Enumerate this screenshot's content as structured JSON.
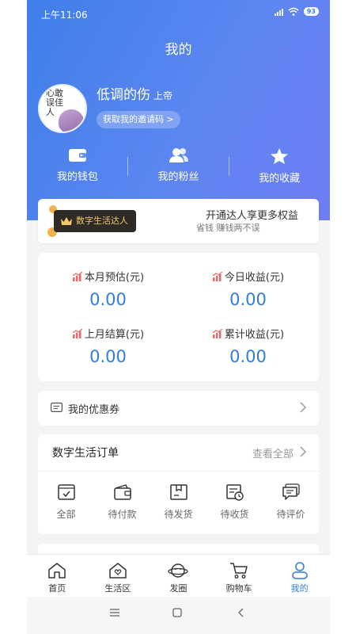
{
  "status_bar": {
    "time": "上午11:06",
    "battery": "93"
  },
  "header": {
    "title": "我的"
  },
  "profile": {
    "name": "低调的伤",
    "level": "上帝",
    "invite_label": "获取我的邀请码 >",
    "avatar_text": "心敢误佳人"
  },
  "quick_actions": [
    {
      "label": "我的钱包",
      "icon": "wallet-icon"
    },
    {
      "label": "我的粉丝",
      "icon": "fans-icon"
    },
    {
      "label": "我的收藏",
      "icon": "star-icon"
    }
  ],
  "vip": {
    "badge": "数字生活达人",
    "headline": "开通达人享更多权益",
    "subline": "省钱 赚钱两不误"
  },
  "earnings": [
    {
      "label": "本月预估(元)",
      "value": "0.00"
    },
    {
      "label": "今日收益(元)",
      "value": "0.00"
    },
    {
      "label": "上月结算(元)",
      "value": "0.00"
    },
    {
      "label": "累计收益(元)",
      "value": "0.00"
    }
  ],
  "coupon": {
    "label": "我的优惠券"
  },
  "orders": {
    "title": "数字生活订单",
    "view_all": "查看全部",
    "items": [
      {
        "label": "全部",
        "icon": "all-orders-icon"
      },
      {
        "label": "待付款",
        "icon": "pending-payment-icon"
      },
      {
        "label": "待发货",
        "icon": "pending-shipment-icon"
      },
      {
        "label": "待收货",
        "icon": "pending-receipt-icon"
      },
      {
        "label": "待评价",
        "icon": "pending-review-icon"
      }
    ]
  },
  "tabbar": [
    {
      "label": "首页",
      "icon": "home-icon",
      "active": false
    },
    {
      "label": "生活区",
      "icon": "life-icon",
      "active": false
    },
    {
      "label": "发圈",
      "icon": "moments-icon",
      "active": false
    },
    {
      "label": "购物车",
      "icon": "cart-icon",
      "active": false
    },
    {
      "label": "我的",
      "icon": "profile-icon",
      "active": true
    }
  ],
  "colors": {
    "accent": "#2f7fd8",
    "header_start": "#3f7fe8",
    "header_end": "#6f7df3",
    "vip_gold": "#f3c86a"
  }
}
